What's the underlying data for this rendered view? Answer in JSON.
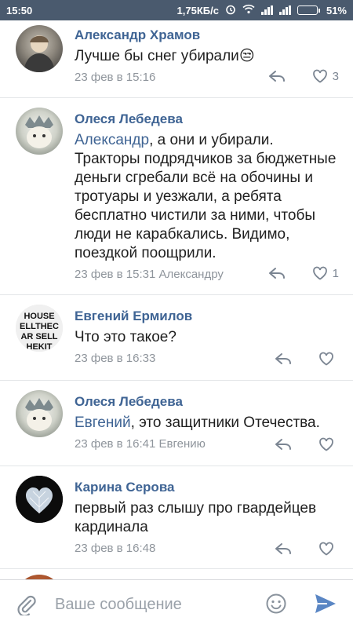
{
  "status_bar": {
    "time": "15:50",
    "net_speed": "1,75КБ/с",
    "battery": "51%",
    "battery_level": 0.51
  },
  "comments": [
    {
      "author": "Александр Храмов",
      "mention": "",
      "text": "Лучше бы снег убирали",
      "emoji": "😒",
      "meta": "23 фев в 15:16",
      "likes": "3"
    },
    {
      "author": "Олеся Лебедева",
      "mention": "Александр",
      "text": ", а они и убирали. Тракторы подрядчиков за бюджетные деньги сгребали всё на обочины и тротуары и уезжали, а ребята бесплатно чистили за ними, чтобы люди не карабкались. Видимо, поездкой поощрили.",
      "emoji": "",
      "meta": "23 фев в 15:31 Александру",
      "likes": "1"
    },
    {
      "author": "Евгений Ермилов",
      "mention": "",
      "text": "Что это такое?",
      "emoji": "",
      "meta": "23 фев в 16:33",
      "likes": ""
    },
    {
      "author": "Олеся Лебедева",
      "mention": "Евгений",
      "text": ", это защитники Отечества.",
      "emoji": "",
      "meta": "23 фев в 16:41 Евгению",
      "likes": ""
    },
    {
      "author": "Карина Серова",
      "mention": "",
      "text": "первый раз слышу про гвардейцев кардинала",
      "emoji": "",
      "meta": "23 фев в 16:48",
      "likes": ""
    }
  ],
  "composer": {
    "placeholder": "Ваше сообщение"
  },
  "icons": {
    "reply": "reply-arrow-icon",
    "like": "heart-icon",
    "attach": "paperclip-icon",
    "emoji": "smiley-icon",
    "send": "send-icon"
  },
  "colors": {
    "status_bar": "#4a5a6e",
    "link": "#3f6494",
    "send": "#5a86c4"
  }
}
